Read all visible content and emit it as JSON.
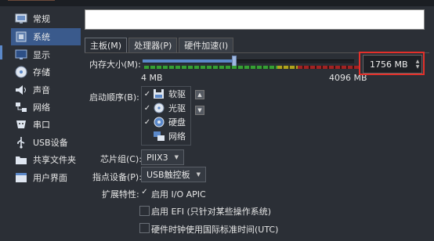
{
  "sidebar": {
    "items": [
      {
        "label": "常规",
        "icon": "monitor-icon"
      },
      {
        "label": "系统",
        "icon": "chip-icon"
      },
      {
        "label": "显示",
        "icon": "display-icon"
      },
      {
        "label": "存储",
        "icon": "disc-icon"
      },
      {
        "label": "声音",
        "icon": "speaker-icon"
      },
      {
        "label": "网络",
        "icon": "network-icon"
      },
      {
        "label": "串口",
        "icon": "serial-port-icon"
      },
      {
        "label": "USB设备",
        "icon": "usb-icon"
      },
      {
        "label": "共享文件夹",
        "icon": "folder-icon"
      },
      {
        "label": "用户界面",
        "icon": "window-icon"
      }
    ],
    "selected_index": 1
  },
  "tabs": [
    {
      "label": "主板(M)",
      "active": true
    },
    {
      "label": "处理器(P)",
      "active": false
    },
    {
      "label": "硬件加速(I)",
      "active": false
    }
  ],
  "memory": {
    "label": "内存大小(M):",
    "min_label": "4 MB",
    "max_label": "4096 MB",
    "value": "1756 MB",
    "value_mb": 1756,
    "min_mb": 4,
    "max_mb": 4096
  },
  "boot_order": {
    "label": "启动顺序(B):",
    "items": [
      {
        "label": "软驱",
        "checked": true,
        "icon": "floppy-icon"
      },
      {
        "label": "光驱",
        "checked": true,
        "icon": "optical-disc-icon"
      },
      {
        "label": "硬盘",
        "checked": true,
        "icon": "hard-disk-icon"
      },
      {
        "label": "网络",
        "checked": false,
        "icon": "network-boot-icon"
      }
    ]
  },
  "chipset": {
    "label": "芯片组(C):",
    "value": "PIIX3"
  },
  "pointing": {
    "label": "指点设备(P):",
    "value": "USB触控板"
  },
  "features": {
    "label": "扩展特性:",
    "options": [
      {
        "label": "启用 I/O APIC",
        "checked": true
      },
      {
        "label": "启用 EFI (只针对某些操作系统)",
        "checked": false
      },
      {
        "label": "硬件时钟使用国际标准时间(UTC)",
        "checked": false
      }
    ]
  },
  "colors": {
    "accent": "#3a5a8c",
    "highlight": "#e3302a"
  }
}
